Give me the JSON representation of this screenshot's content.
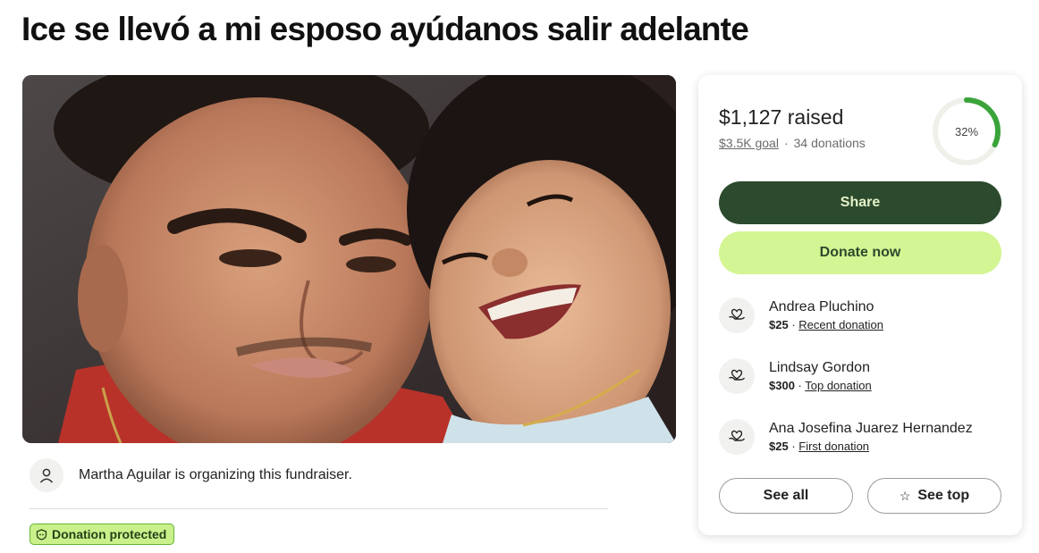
{
  "page": {
    "title": "Ice se llevó a mi esposo ayúdanos salir adelante"
  },
  "organizer": {
    "text": "Martha Aguilar is organizing this fundraiser."
  },
  "protection": {
    "label": "Donation protected"
  },
  "donation_card": {
    "raised": "$1,127 raised",
    "goal": "$3.5K goal",
    "separator": "·",
    "donations": "34 donations",
    "progress_label": "32%",
    "progress_fraction": 0.32,
    "share_label": "Share",
    "donate_label": "Donate now",
    "donors": [
      {
        "name": "Andrea Pluchino",
        "amount": "$25",
        "sep": " · ",
        "tag": "Recent donation"
      },
      {
        "name": "Lindsay Gordon",
        "amount": "$300",
        "sep": " · ",
        "tag": "Top donation"
      },
      {
        "name": "Ana Josefina Juarez Hernandez",
        "amount": "$25",
        "sep": " · ",
        "tag": "First donation"
      }
    ],
    "see_all_label": "See all",
    "see_top_label": "See top",
    "see_top_icon": "☆"
  },
  "colors": {
    "share_bg": "#2c4a2d",
    "donate_bg": "#d4f593",
    "progress": "#3aa43a",
    "badge_bg": "#c9f08a"
  }
}
